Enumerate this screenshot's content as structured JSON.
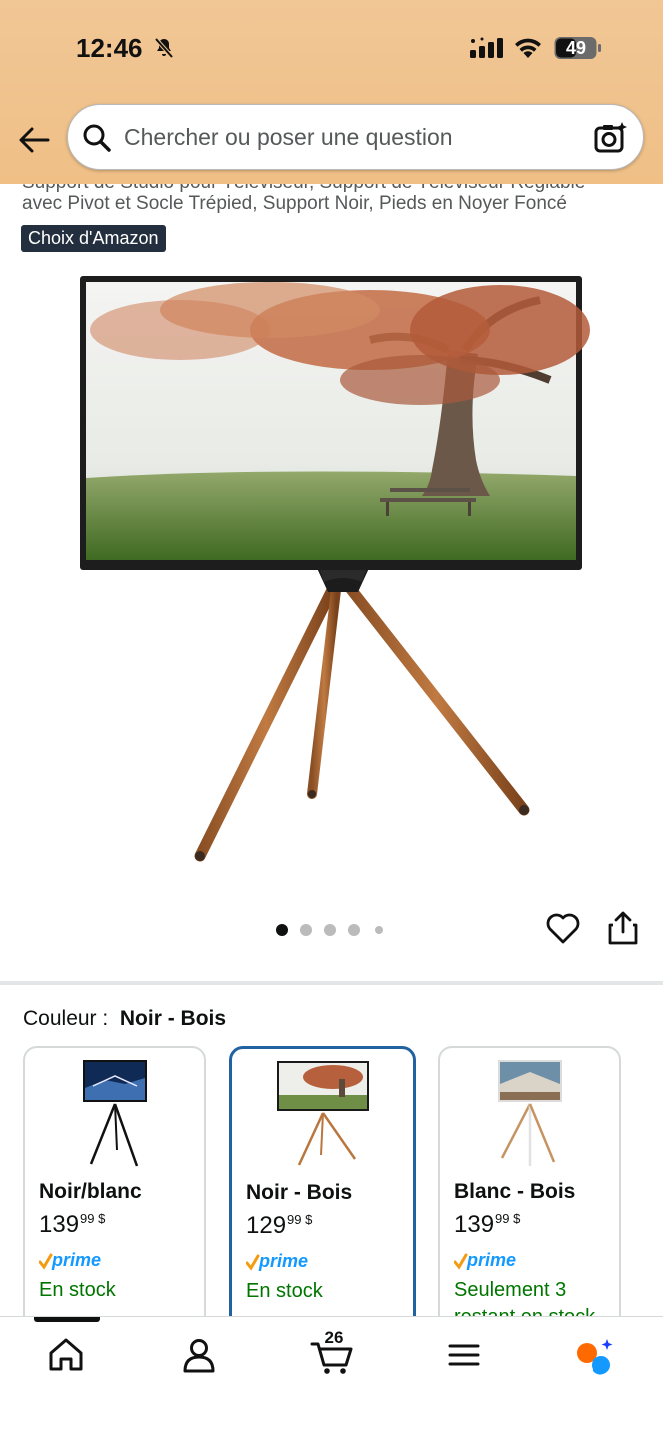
{
  "status_bar": {
    "time": "12:46",
    "battery": "49"
  },
  "header": {
    "search_placeholder": "Chercher ou poser une question"
  },
  "product": {
    "title_line1": "Support de Studio pour Téléviseur, Support de Téléviseur Réglable",
    "title_line2": "avec Pivot et Socle Trépied, Support Noir, Pieds en Noyer Foncé",
    "badge": "Choix d'Amazon",
    "image_count": 5,
    "active_image": 1
  },
  "color_selector": {
    "label": "Couleur :",
    "selected": "Noir - Bois",
    "options": [
      {
        "name": "Noir/blanc",
        "price_whole": "139",
        "price_fraction": "99 $",
        "prime": "prime",
        "stock": "En stock"
      },
      {
        "name": "Noir - Bois",
        "price_whole": "129",
        "price_fraction": "99 $",
        "prime": "prime",
        "stock": "En stock"
      },
      {
        "name": "Blanc - Bois",
        "price_whole": "139",
        "price_fraction": "99 $",
        "prime": "prime",
        "stock": "Seulement 3 restant en stock"
      }
    ]
  },
  "bottom_nav": {
    "cart_count": "26"
  },
  "colors": {
    "header_bg": "#efc28b",
    "badge_bg": "#232f3e",
    "selected_border": "#2162a1",
    "stock_green": "#007600",
    "prime_blue": "#1399ff",
    "prime_check": "#f39c12"
  }
}
